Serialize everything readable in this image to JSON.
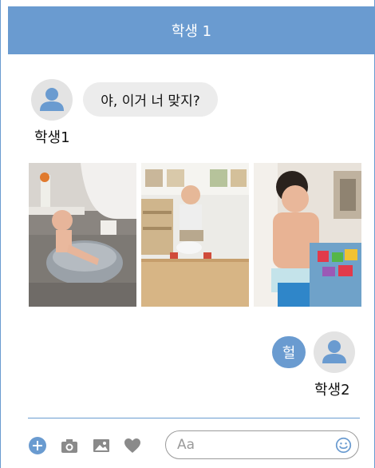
{
  "header": {
    "title": "학생 1"
  },
  "messages": [
    {
      "sender": "학생1",
      "text": "야, 이거 너 맞지?",
      "side": "left",
      "avatar_icon": "person-icon"
    },
    {
      "sender": "학생2",
      "text": "헐",
      "side": "right",
      "avatar_icon": "person-icon"
    }
  ],
  "photos": [
    {
      "name": "photo-child-bath"
    },
    {
      "name": "photo-child-potty"
    },
    {
      "name": "photo-child-toy"
    }
  ],
  "composer": {
    "placeholder": "Aa",
    "icons": [
      "plus-circle-icon",
      "camera-icon",
      "gallery-icon",
      "heart-icon",
      "emoji-icon"
    ]
  },
  "colors": {
    "accent": "#6a9bd0",
    "bubble_gray": "#ececec",
    "avatar_bg": "#e3e3e3",
    "icon_gray": "#8a8a8a"
  }
}
